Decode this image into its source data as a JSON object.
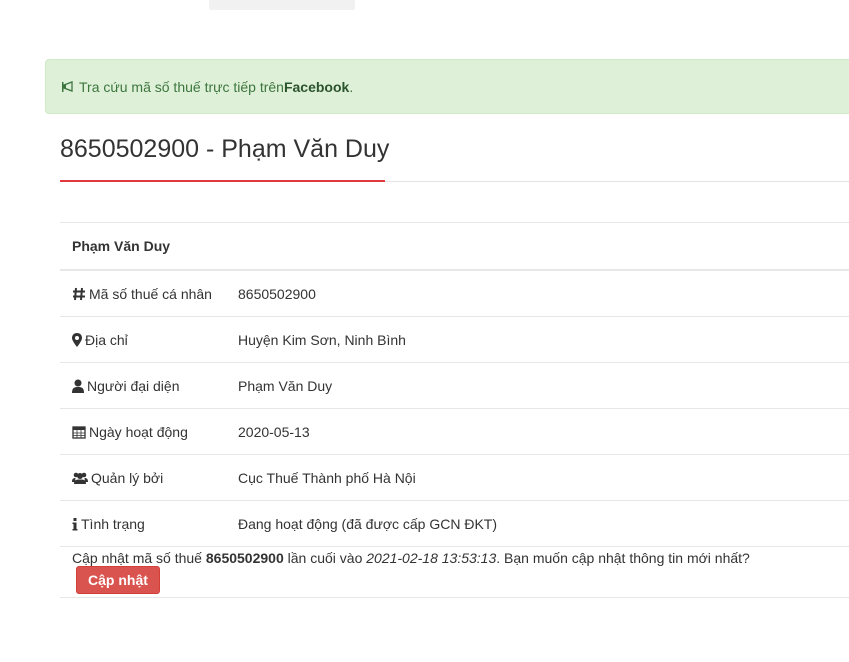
{
  "alert": {
    "text_prefix": "Tra cứu mã số thuế trực tiếp trên ",
    "link": "Facebook",
    "suffix": "."
  },
  "page": {
    "title": "8650502900 - Phạm Văn Duy"
  },
  "table": {
    "header": "Phạm Văn Duy",
    "rows": [
      {
        "icon": "hash-icon",
        "label": "Mã số thuế cá nhân",
        "value": "8650502900"
      },
      {
        "icon": "map-marker-icon",
        "label": "Địa chỉ",
        "value": "Huyện Kim Sơn, Ninh Bình"
      },
      {
        "icon": "user-icon",
        "label": "Người đại diện",
        "value": "Phạm Văn Duy"
      },
      {
        "icon": "calendar-icon",
        "label": "Ngày hoạt động",
        "value": "2020-05-13"
      },
      {
        "icon": "users-icon",
        "label": "Quản lý bởi",
        "value": "Cục Thuế Thành phố Hà Nội"
      },
      {
        "icon": "info-icon",
        "label": "Tình trạng",
        "value": "Đang hoạt động (đã được cấp GCN ĐKT)"
      }
    ],
    "footer": {
      "prefix": "Cập nhật mã số thuế ",
      "tax_code": "8650502900",
      "middle": " lần cuối vào ",
      "timestamp": "2021-02-18 13:53:13",
      "suffix": ". Bạn muốn cập nhật thông tin mới nhất?",
      "button_label": "Cập nhật"
    }
  },
  "colors": {
    "accent": "#e0393e",
    "alert_bg": "#dff0d8",
    "button": "#d9534f"
  }
}
